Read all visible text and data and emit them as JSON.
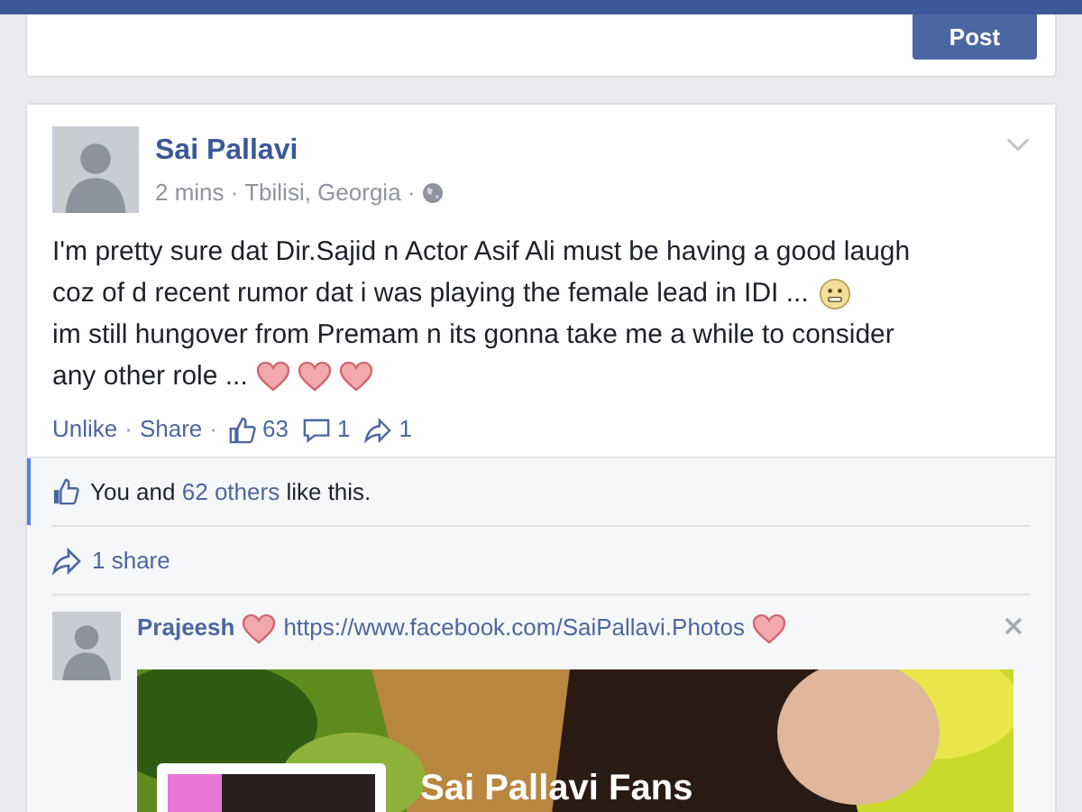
{
  "composer": {
    "post_button": "Post"
  },
  "post": {
    "author": "Sai Pallavi",
    "meta": "2 mins · Tbilisi, Georgia ·",
    "lines": [
      {
        "text": "I'm pretty sure dat Dir.Sajid n Actor Asif Ali must be having a good laugh"
      },
      {
        "text": "coz of d recent rumor dat i was playing the female lead in IDI ...",
        "icons": [
          {
            "kind": "smile"
          }
        ]
      },
      {
        "text": "im still hungover from Premam n its gonna take me a while to consider"
      },
      {
        "text": "any other role ...",
        "icons": [
          {
            "kind": "heart"
          },
          {
            "kind": "heart"
          },
          {
            "kind": "heart"
          }
        ]
      }
    ],
    "actions": [
      {
        "label": "Unlike",
        "separator": "·"
      },
      {
        "label": "Share",
        "separator": "·"
      }
    ],
    "counts": {
      "likes": "63",
      "comments": "1",
      "shares": "1"
    }
  },
  "likes_summary": {
    "prefix": "You and",
    "link": "62 others",
    "suffix": "like this."
  },
  "shares_summary": "1 share",
  "comment": {
    "parts": [
      {
        "kind": "author",
        "text": "Prajeesh"
      },
      {
        "kind": "heart"
      },
      {
        "kind": "link",
        "text": "https://www.facebook.com/SaiPallavi.Photos"
      },
      {
        "kind": "heart"
      }
    ],
    "preview": {
      "kind": "picture",
      "page_name": "Sai Pallavi Fans"
    }
  }
}
